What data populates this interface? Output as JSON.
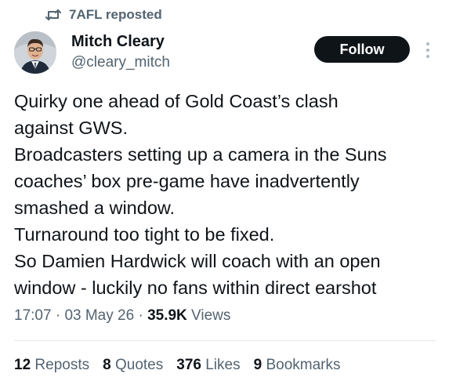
{
  "repost": {
    "icon": "repost-icon",
    "label": "7AFL reposted"
  },
  "author": {
    "avatar": "avatar",
    "name": "Mitch Cleary",
    "handle": "@cleary_mitch"
  },
  "follow_button": {
    "label": "Follow",
    "background": "#0f1419",
    "text_color": "#ffffff"
  },
  "more_icon": "more-vertical-icon",
  "body_lines": [
    "Quirky one ahead of Gold Coast’s clash",
    "against GWS.",
    "Broadcasters setting up a camera in the Suns",
    "coaches’ box pre-game have inadvertently",
    "smashed a window.",
    "Turnaround too tight to be fixed.",
    "So Damien Hardwick will coach with an open",
    "window - luckily no fans within direct earshot"
  ],
  "meta": {
    "time": "17:07",
    "separator": "·",
    "date": "03 May 26",
    "views_count": "35.9K",
    "views_label": "Views"
  },
  "stats": [
    {
      "num": "12",
      "label": "Reposts"
    },
    {
      "num": "8",
      "label": "Quotes"
    },
    {
      "num": "376",
      "label": "Likes"
    },
    {
      "num": "9",
      "label": "Bookmarks"
    }
  ],
  "colors": {
    "text_primary": "#0f1419",
    "text_secondary": "#536471",
    "divider": "#e3e7ea"
  }
}
